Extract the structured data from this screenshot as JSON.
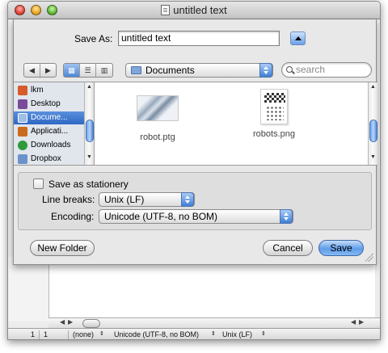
{
  "window": {
    "title": "untitled text"
  },
  "save_as": {
    "label": "Save As:",
    "value": "untitled text"
  },
  "toolbar": {
    "location": "Documents",
    "search_placeholder": "search"
  },
  "sidebar": {
    "items": [
      {
        "label": "lkm",
        "icon": "home-icon",
        "color": "#d65b28"
      },
      {
        "label": "Desktop",
        "icon": "desktop-icon",
        "color": "#7b4a9a"
      },
      {
        "label": "Docume...",
        "icon": "documents-folder-icon",
        "color": "#6b93c9",
        "selected": true
      },
      {
        "label": "Applicati...",
        "icon": "applications-icon",
        "color": "#c86b1e"
      },
      {
        "label": "Downloads",
        "icon": "downloads-icon",
        "color": "#2e9b3a"
      },
      {
        "label": "Dropbox",
        "icon": "dropbox-folder-icon",
        "color": "#6b93c9"
      }
    ]
  },
  "files": [
    {
      "name": "robot.ptg"
    },
    {
      "name": "robots.png"
    }
  ],
  "options": {
    "stationery_label": "Save as stationery",
    "line_breaks_label": "Line breaks:",
    "line_breaks_value": "Unix (LF)",
    "encoding_label": "Encoding:",
    "encoding_value": "Unicode (UTF-8, no BOM)"
  },
  "buttons": {
    "new_folder": "New Folder",
    "cancel": "Cancel",
    "save": "Save"
  },
  "status": {
    "line": "1",
    "col": "1",
    "mode": "(none)",
    "encoding": "Unicode (UTF-8, no BOM)",
    "line_breaks": "Unix (LF)"
  }
}
